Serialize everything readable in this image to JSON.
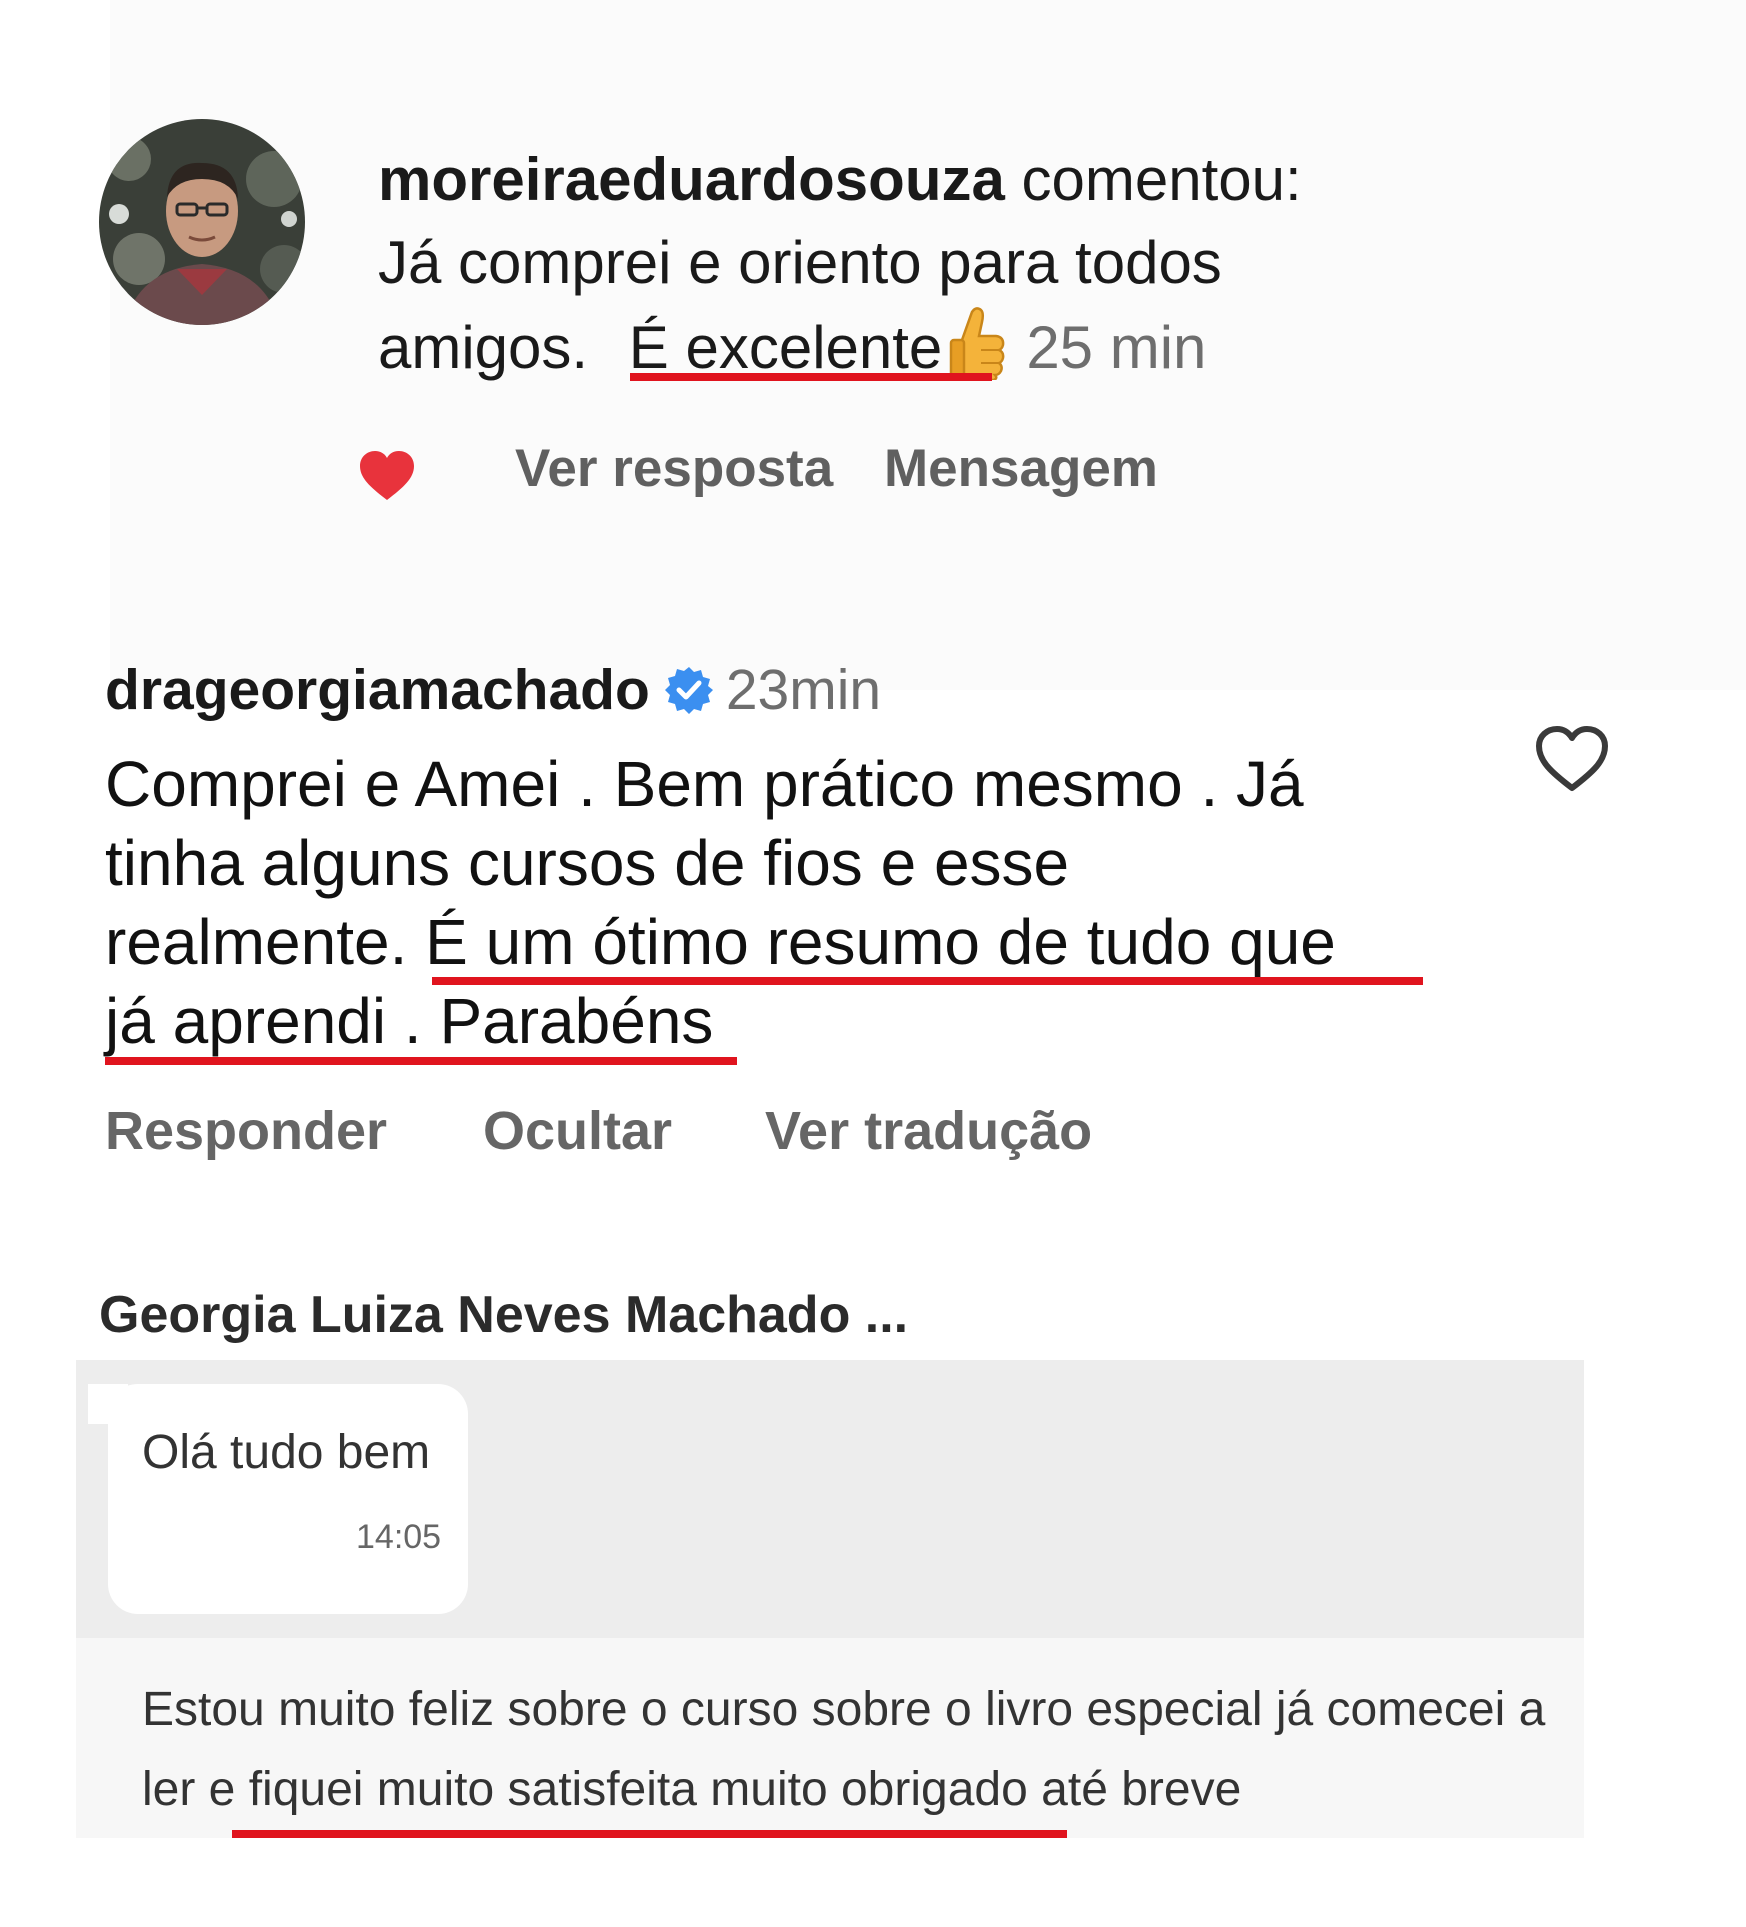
{
  "comment1": {
    "username": "moreiraeduardosouza",
    "verb": "comentou:",
    "line2": "Já comprei e oriento para todos",
    "line3_start": "amigos.",
    "highlight": "É excelente",
    "emoji": "thumbs-up",
    "time": "25 min",
    "liked": true,
    "actions": {
      "reply": "Ver resposta",
      "message": "Mensagem"
    }
  },
  "comment2": {
    "username": "drageorgiamachado",
    "verified": true,
    "time": "23min",
    "lines": [
      "Comprei e Amei . Bem prático mesmo . Já",
      "tinha alguns cursos de fios e esse"
    ],
    "line3_start": "realmente.",
    "line3_highlight": "É um ótimo resumo de tudo que",
    "line4_highlight": "já aprendi . Parabéns",
    "actions": {
      "reply": "Responder",
      "hide": "Ocultar",
      "translate": "Ver tradução"
    }
  },
  "chat": {
    "contact_name": "Georgia Luiza Neves Machado ...",
    "message1": {
      "text": "Olá tudo bem",
      "time": "14:05"
    },
    "message2": {
      "line1": "Estou muito feliz sobre o curso sobre o livro especial já comecei a",
      "line2_start": "ler e",
      "line2_highlight": "fiquei muito satisfeita muito obrigado",
      "line2_end": "até breve"
    }
  },
  "colors": {
    "underline": "#e0141e",
    "heart": "#e8333c",
    "verified": "#3b8ff0",
    "muted_text": "#6e6e6e"
  }
}
